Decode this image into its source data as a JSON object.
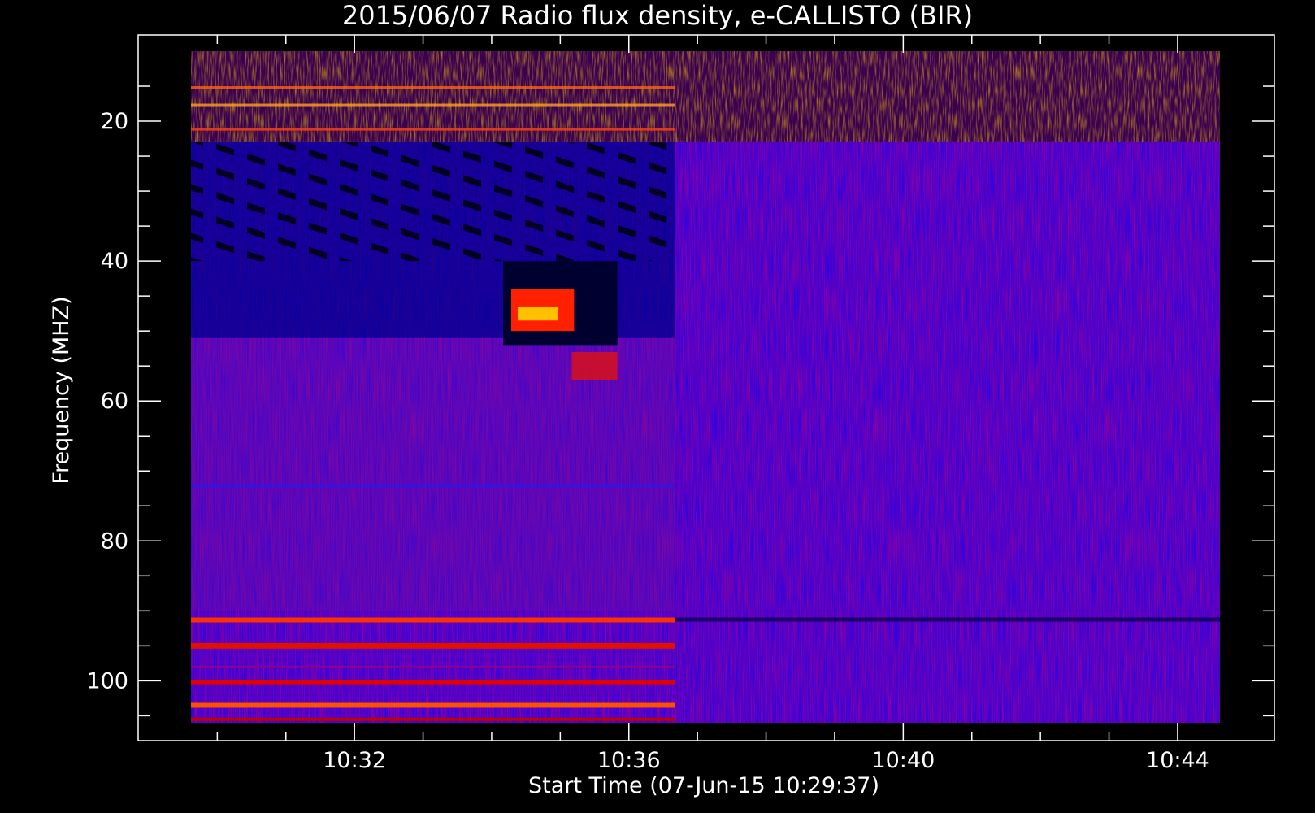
{
  "chart_data": {
    "type": "heatmap",
    "title": "2015/06/07  Radio flux density, e-CALLISTO (BIR)",
    "xlabel": "Start Time (07-Jun-15 10:29:37)",
    "ylabel": "Frequency (MHZ)",
    "x_range_minutes": [
      "10:29:37",
      "10:44:37"
    ],
    "y_range_mhz": [
      10,
      106
    ],
    "y_axis_inverted": true,
    "x_ticks": [
      "10:32",
      "10:36",
      "10:40",
      "10:44"
    ],
    "y_ticks": [
      20,
      40,
      60,
      80,
      100
    ],
    "colormap": [
      "#000000",
      "#0000ff",
      "#ff0000",
      "#ffff00"
    ],
    "background_color": "#000000",
    "axis_color": "#ffffff",
    "features": [
      {
        "name": "interference band top",
        "freq_mhz": [
          10,
          23
        ],
        "time": [
          "10:29:37",
          "10:44:37"
        ]
      },
      {
        "name": "burst",
        "freq_mhz": [
          41,
          58
        ],
        "time": [
          "10:34:10",
          "10:35:50"
        ]
      },
      {
        "name": "lower bands",
        "freq_mhz": [
          90,
          106
        ],
        "time": [
          "10:29:37",
          "10:36:40"
        ]
      }
    ]
  }
}
